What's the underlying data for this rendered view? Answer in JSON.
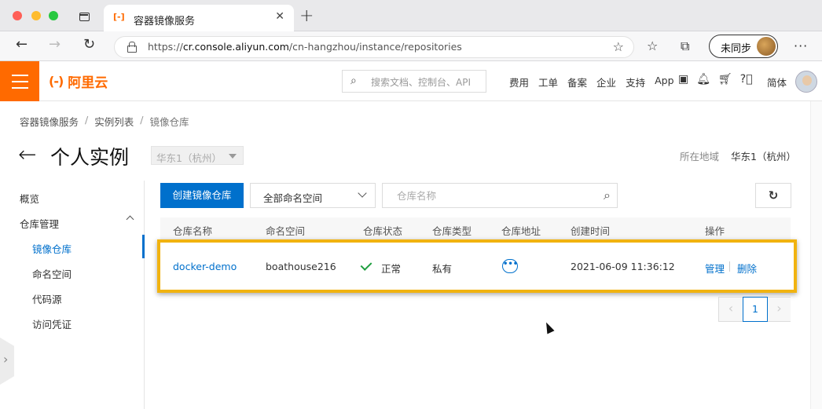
{
  "browser": {
    "tab_title": "容器镜像服务",
    "tab_favicon": "[-]",
    "url_prefix": "https://",
    "url_host": "cr.console.aliyun.com",
    "url_path": "/cn-hangzhou/instance/repositories",
    "profile_label": "未同步"
  },
  "topnav": {
    "logo_mark": "(-)",
    "logo_text": "阿里云",
    "search_placeholder": "搜索文档、控制台、API",
    "links": [
      "费用",
      "工单",
      "备案",
      "企业",
      "支持",
      "App"
    ],
    "lang": "简体"
  },
  "breadcrumb": {
    "items": [
      "容器镜像服务",
      "实例列表",
      "镜像仓库"
    ],
    "separator": "/"
  },
  "header": {
    "title": "个人实例",
    "region_select": "华东1（杭州）",
    "region_label": "所在地域",
    "region_value": "华东1（杭州）"
  },
  "sidebar": {
    "items": [
      {
        "label": "概览"
      },
      {
        "label": "仓库管理"
      },
      {
        "label": "镜像仓库"
      },
      {
        "label": "命名空间"
      },
      {
        "label": "代码源"
      },
      {
        "label": "访问凭证"
      }
    ]
  },
  "toolbar": {
    "create_label": "创建镜像仓库",
    "namespace_select": "全部命名空间",
    "search_placeholder": "仓库名称"
  },
  "table": {
    "columns": [
      "仓库名称",
      "命名空间",
      "仓库状态",
      "仓库类型",
      "仓库地址",
      "创建时间",
      "操作"
    ],
    "rows": [
      {
        "name": "docker-demo",
        "namespace": "boathouse216",
        "status": "正常",
        "type": "私有",
        "address": "•••",
        "created": "2021-06-09 11:36:12",
        "action_manage": "管理",
        "action_delete": "删除"
      }
    ]
  },
  "pagination": {
    "current": "1",
    "prev": "‹",
    "next": "›"
  },
  "colors": {
    "brand_orange": "#ff6a00",
    "primary_blue": "#0070cc",
    "highlight_yellow": "#f1b310",
    "status_green": "#1e9e3f"
  }
}
